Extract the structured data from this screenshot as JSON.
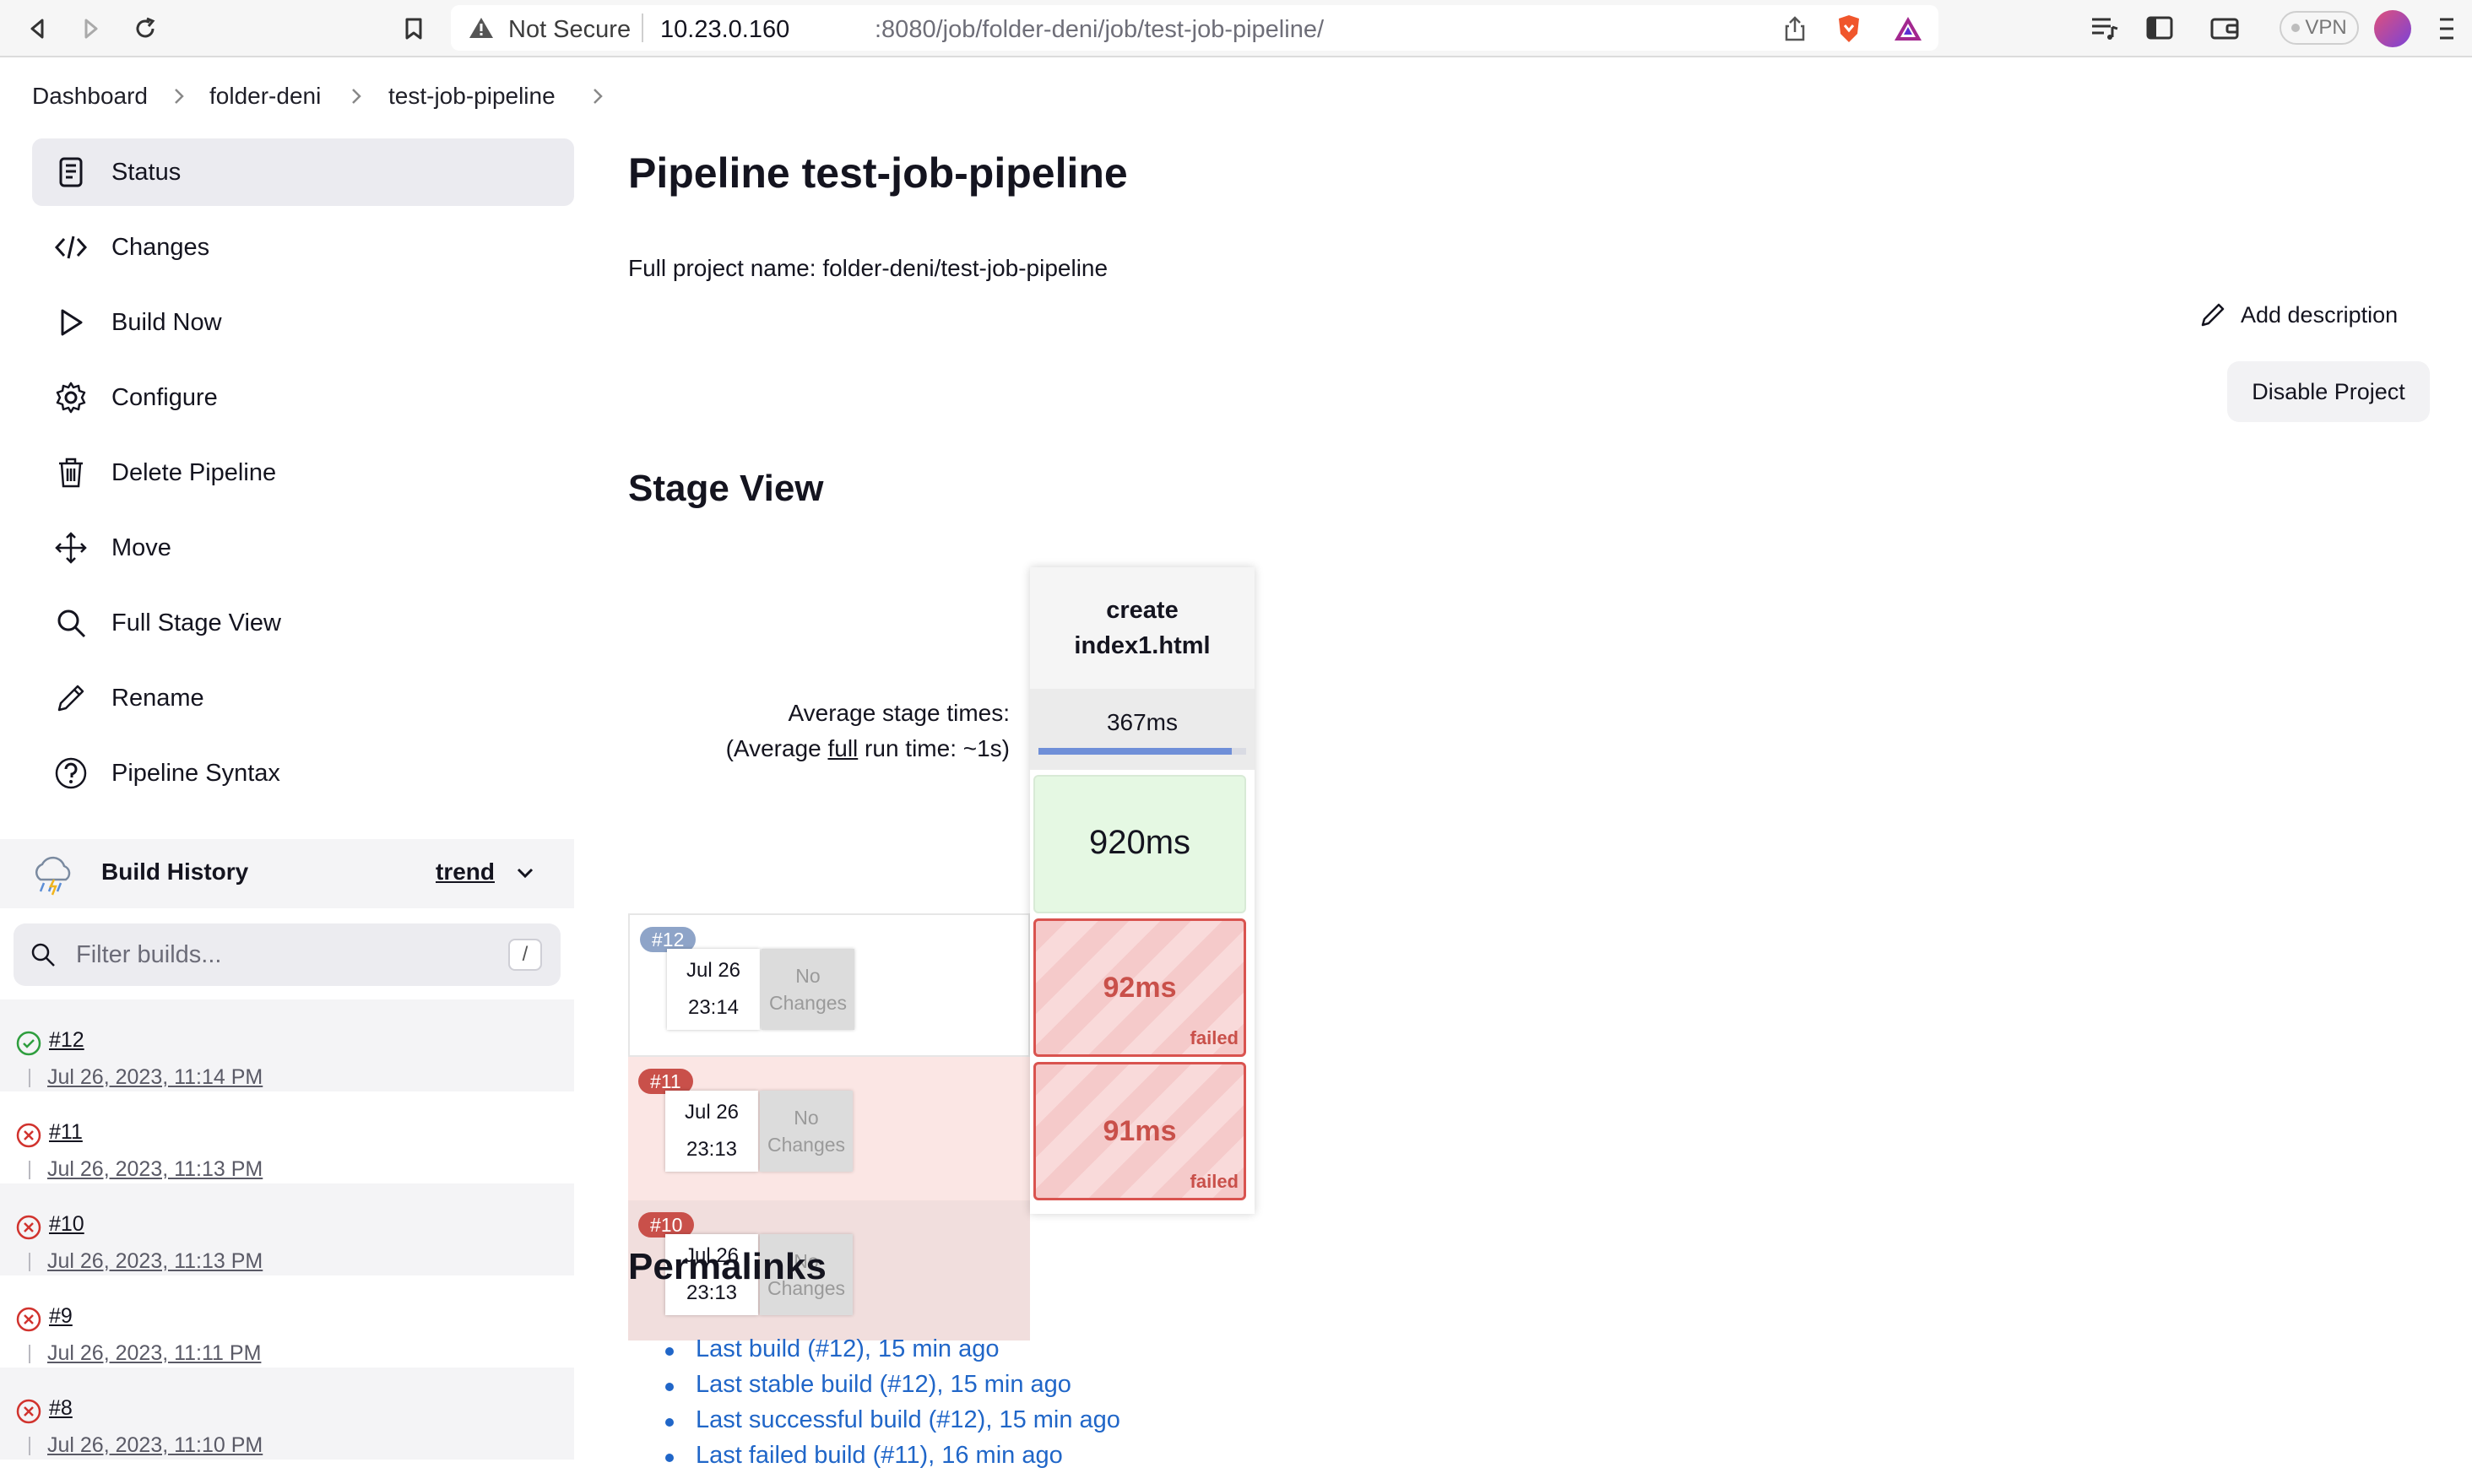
{
  "browser": {
    "security_label": "Not Secure",
    "url_host": "10.23.0.160",
    "url_path": ":8080/job/folder-deni/job/test-job-pipeline/",
    "vpn_label": "VPN"
  },
  "breadcrumb": [
    "Dashboard",
    "folder-deni",
    "test-job-pipeline"
  ],
  "sidebar": {
    "tasks": [
      {
        "label": "Status",
        "icon": "status-icon",
        "active": true
      },
      {
        "label": "Changes",
        "icon": "code-icon"
      },
      {
        "label": "Build Now",
        "icon": "play-icon"
      },
      {
        "label": "Configure",
        "icon": "gear-icon"
      },
      {
        "label": "Delete Pipeline",
        "icon": "trash-icon"
      },
      {
        "label": "Move",
        "icon": "move-icon"
      },
      {
        "label": "Full Stage View",
        "icon": "search-icon"
      },
      {
        "label": "Rename",
        "icon": "pencil-icon"
      },
      {
        "label": "Pipeline Syntax",
        "icon": "help-icon"
      }
    ],
    "build_history": {
      "title": "Build History",
      "trend_label": "trend",
      "filter_placeholder": "Filter builds...",
      "filter_shortcut": "/",
      "builds": [
        {
          "number": "#12",
          "date": "Jul 26, 2023, 11:14 PM",
          "status": "success"
        },
        {
          "number": "#11",
          "date": "Jul 26, 2023, 11:13 PM",
          "status": "failed"
        },
        {
          "number": "#10",
          "date": "Jul 26, 2023, 11:13 PM",
          "status": "failed"
        },
        {
          "number": "#9",
          "date": "Jul 26, 2023, 11:11 PM",
          "status": "failed"
        },
        {
          "number": "#8",
          "date": "Jul 26, 2023, 11:10 PM",
          "status": "failed"
        }
      ]
    }
  },
  "main": {
    "title": "Pipeline test-job-pipeline",
    "full_project_name": "Full project name: folder-deni/test-job-pipeline",
    "add_description_label": "Add description",
    "disable_button_label": "Disable Project",
    "stage_view": {
      "title": "Stage View",
      "stage_name": "create index1.html",
      "avg_label_line1": "Average stage times:",
      "avg_label_pre": "(Average ",
      "avg_label_link": "full",
      "avg_label_post": " run time: ~1s)",
      "avg_stage_time": "367ms",
      "avg_bar_fraction": 0.93,
      "runs": [
        {
          "badge": "#12",
          "date": "Jul 26",
          "time": "23:14",
          "changes": "No Changes",
          "duration": "920ms",
          "status": "success"
        },
        {
          "badge": "#11",
          "date": "Jul 26",
          "time": "23:13",
          "changes": "No Changes",
          "duration": "92ms",
          "status": "failed",
          "status_label": "failed"
        },
        {
          "badge": "#10",
          "date": "Jul 26",
          "time": "23:13",
          "changes": "No Changes",
          "duration": "91ms",
          "status": "failed",
          "status_label": "failed"
        }
      ]
    },
    "permalinks": {
      "title": "Permalinks",
      "links": [
        "Last build (#12), 15 min ago",
        "Last stable build (#12), 15 min ago",
        "Last successful build (#12), 15 min ago",
        "Last failed build (#11), 16 min ago"
      ]
    }
  },
  "colors": {
    "link_blue": "#2066c8",
    "failed_red": "#c9504a",
    "success_green": "#2e9e3e",
    "stage_success_bg": "#e5f8e3"
  }
}
